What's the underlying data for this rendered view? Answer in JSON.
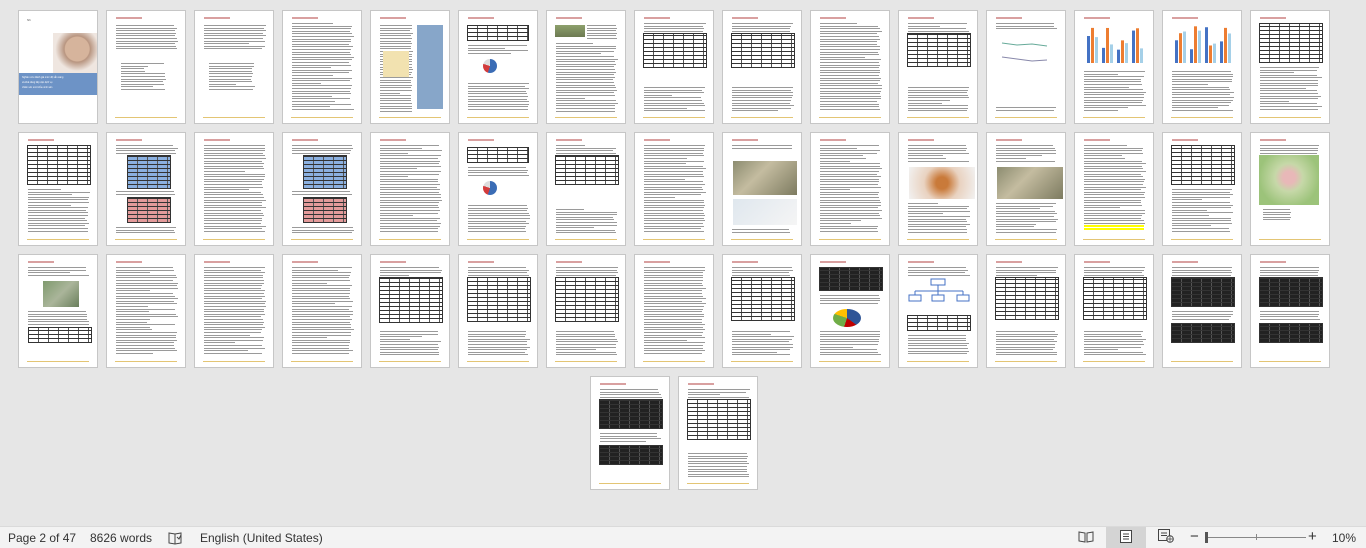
{
  "document": {
    "total_pages": 47,
    "cover": {
      "label": "Nh",
      "title_lines": [
        "Nghiên cứu đánh giá mức độ sẵn sàng",
        "và khả năng tiếp cận dịch vụ",
        "chăm sóc sức khỏe sinh sản"
      ]
    },
    "highlight_color": "#ffff00"
  },
  "statusbar": {
    "page_indicator": "Page 2 of 47",
    "word_count": "8626 words",
    "proofing_icon": "proofing-book-icon",
    "language": "English (United States)",
    "view_buttons": [
      {
        "name": "read-mode",
        "icon": "book-open-icon",
        "active": false
      },
      {
        "name": "print-layout",
        "icon": "page-layout-icon",
        "active": true
      },
      {
        "name": "web-layout",
        "icon": "web-layout-icon",
        "active": false
      }
    ],
    "zoom_out": "−",
    "zoom_in": "+",
    "zoom_level": "10%",
    "zoom_fraction": 0.1
  }
}
